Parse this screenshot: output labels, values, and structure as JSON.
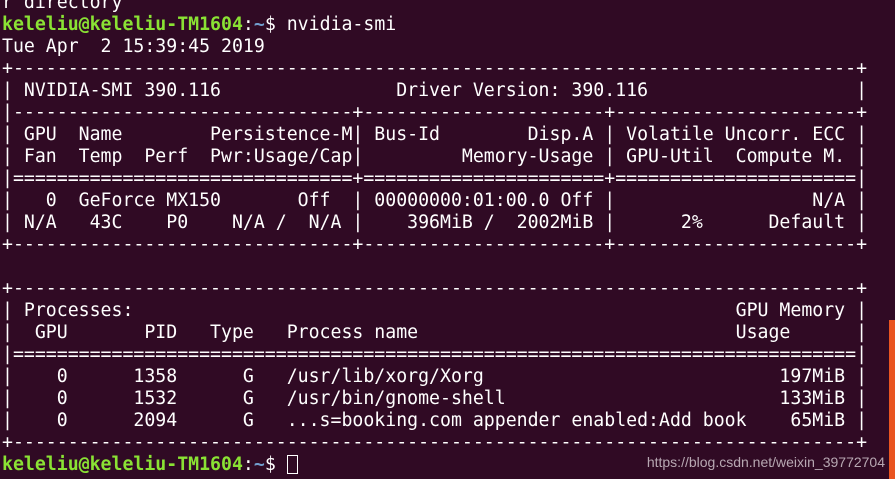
{
  "terminal": {
    "colors": {
      "background": "#300a24",
      "text": "#ffffff",
      "user": "#8ae234",
      "path": "#729fcf",
      "scrollbar": "#e95420"
    },
    "lines": [
      {
        "kind": "text",
        "text": "r directory"
      },
      {
        "kind": "prompt",
        "user": "keleliu@keleliu-TM1604",
        "sep": ":",
        "path": "~",
        "symbol": "$ ",
        "command": "nvidia-smi"
      },
      {
        "kind": "text",
        "text": "Tue Apr  2 15:39:45 2019"
      },
      {
        "kind": "text",
        "text": "+-----------------------------------------------------------------------------+"
      },
      {
        "kind": "text",
        "text": "| NVIDIA-SMI 390.116                Driver Version: 390.116                   |"
      },
      {
        "kind": "text",
        "text": "|-------------------------------+----------------------+----------------------+"
      },
      {
        "kind": "text",
        "text": "| GPU  Name        Persistence-M| Bus-Id        Disp.A | Volatile Uncorr. ECC |"
      },
      {
        "kind": "text",
        "text": "| Fan  Temp  Perf  Pwr:Usage/Cap|         Memory-Usage | GPU-Util  Compute M. |"
      },
      {
        "kind": "text",
        "text": "|===============================+======================+======================|"
      },
      {
        "kind": "text",
        "text": "|   0  GeForce MX150       Off  | 00000000:01:00.0 Off |                  N/A |"
      },
      {
        "kind": "text",
        "text": "| N/A   43C    P0    N/A /  N/A |    396MiB /  2002MiB |      2%      Default |"
      },
      {
        "kind": "text",
        "text": "+-------------------------------+----------------------+----------------------+"
      },
      {
        "kind": "text",
        "text": ""
      },
      {
        "kind": "text",
        "text": "+-----------------------------------------------------------------------------+"
      },
      {
        "kind": "text",
        "text": "| Processes:                                                       GPU Memory |"
      },
      {
        "kind": "text",
        "text": "|  GPU       PID   Type   Process name                             Usage      |"
      },
      {
        "kind": "text",
        "text": "|=============================================================================|"
      },
      {
        "kind": "text",
        "text": "|    0      1358      G   /usr/lib/xorg/Xorg                           197MiB |"
      },
      {
        "kind": "text",
        "text": "|    0      1532      G   /usr/bin/gnome-shell                         133MiB |"
      },
      {
        "kind": "text",
        "text": "|    0      2094      G   ...s=booking.com appender enabled:Add book    65MiB |"
      },
      {
        "kind": "text",
        "text": "+-----------------------------------------------------------------------------+"
      },
      {
        "kind": "prompt",
        "user": "keleliu@keleliu-TM1604",
        "sep": ":",
        "path": "~",
        "symbol": "$ ",
        "command": "",
        "cursor": true
      }
    ]
  },
  "watermark": "https://blog.csdn.net/weixin_39772704"
}
